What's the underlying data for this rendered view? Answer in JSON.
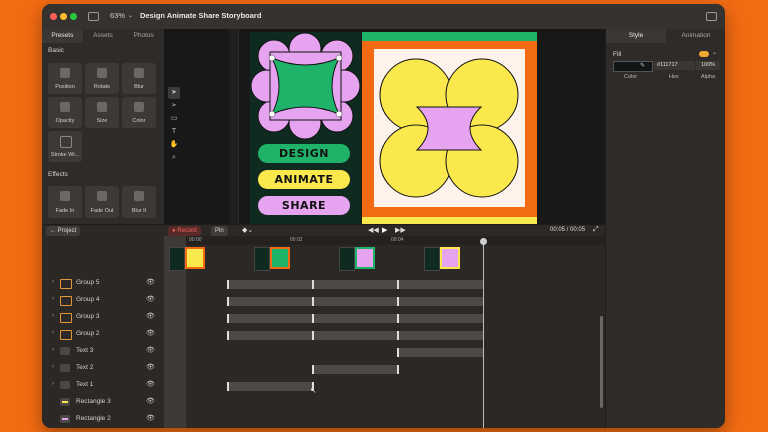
{
  "titlebar": {
    "zoom": "63%",
    "title": "Design Animate Share Storyboard"
  },
  "left_panel": {
    "tabs": [
      "Presets",
      "Assets",
      "Photos"
    ],
    "basic_title": "Basic",
    "basic_tools": [
      "Position",
      "Rotate",
      "Blur",
      "Opacity",
      "Size",
      "Color",
      "Stroke Wi..."
    ],
    "effects_title": "Effects",
    "effects_tools": [
      "Fade In",
      "Fade Out",
      "Blur It"
    ]
  },
  "canvas": {
    "words": [
      "DESIGN",
      "ANIMATE",
      "SHARE"
    ],
    "colors": {
      "green": "#1fb36a",
      "pink": "#e5a3f0",
      "yellow": "#fbe84d",
      "orange": "#f26b12",
      "cream": "#fdf3ea",
      "dark": "#0f2a1f"
    }
  },
  "right_panel": {
    "tabs": [
      "Style",
      "Animation"
    ],
    "fill_label": "Fill",
    "color_label": "Color",
    "hex_value": "#111717",
    "hex_label": "Hex",
    "alpha_value": "100%",
    "alpha_label": "Alpha"
  },
  "midbar": {
    "project_label": "← Project",
    "record_label": "● Record",
    "pin_label": "Pin",
    "time": "00:05 / 00:05"
  },
  "timeline": {
    "ticks": [
      "00:00",
      "00:02",
      "00:04"
    ],
    "layers": [
      {
        "name": "Group 5",
        "type": "group"
      },
      {
        "name": "Group 4",
        "type": "group"
      },
      {
        "name": "Group 3",
        "type": "group"
      },
      {
        "name": "Group 2",
        "type": "group"
      },
      {
        "name": "Text 3",
        "type": "text"
      },
      {
        "name": "Text 2",
        "type": "text"
      },
      {
        "name": "Text 1",
        "type": "text"
      },
      {
        "name": "Rectangle 3",
        "type": "rect-yellow"
      },
      {
        "name": "Rectangle 2",
        "type": "rect-pink"
      }
    ]
  }
}
